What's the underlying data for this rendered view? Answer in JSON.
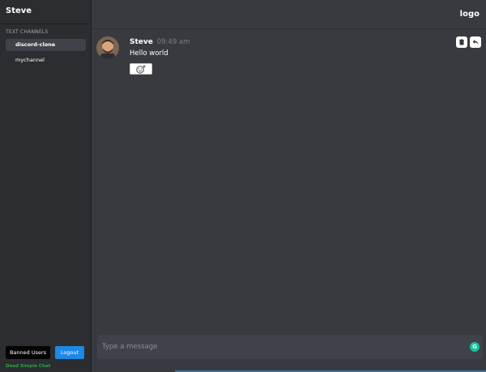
{
  "sidebar": {
    "server_name": "Steve",
    "section_label": "TEXT CHANNELS",
    "channels": [
      {
        "label": "discord-clone",
        "active": true
      },
      {
        "label": "mychannel",
        "active": false
      }
    ],
    "banned_users_label": "Banned Users",
    "logout_label": "Logout",
    "brand": "Dead Simple Chat"
  },
  "header": {
    "logo": "logo"
  },
  "messages": [
    {
      "author": "Steve",
      "time": "09:49 am",
      "text": "Hello world",
      "avatar_icon": "user-avatar",
      "actions": [
        "trash-icon",
        "reply-icon"
      ]
    }
  ],
  "composer": {
    "placeholder": "Type a message"
  },
  "colors": {
    "sidebar_bg": "#2b2d31",
    "main_bg": "#383a40",
    "logout_blue": "#1e88e5",
    "brand_green": "#2ea043",
    "grammarly_green": "#15c39a"
  }
}
